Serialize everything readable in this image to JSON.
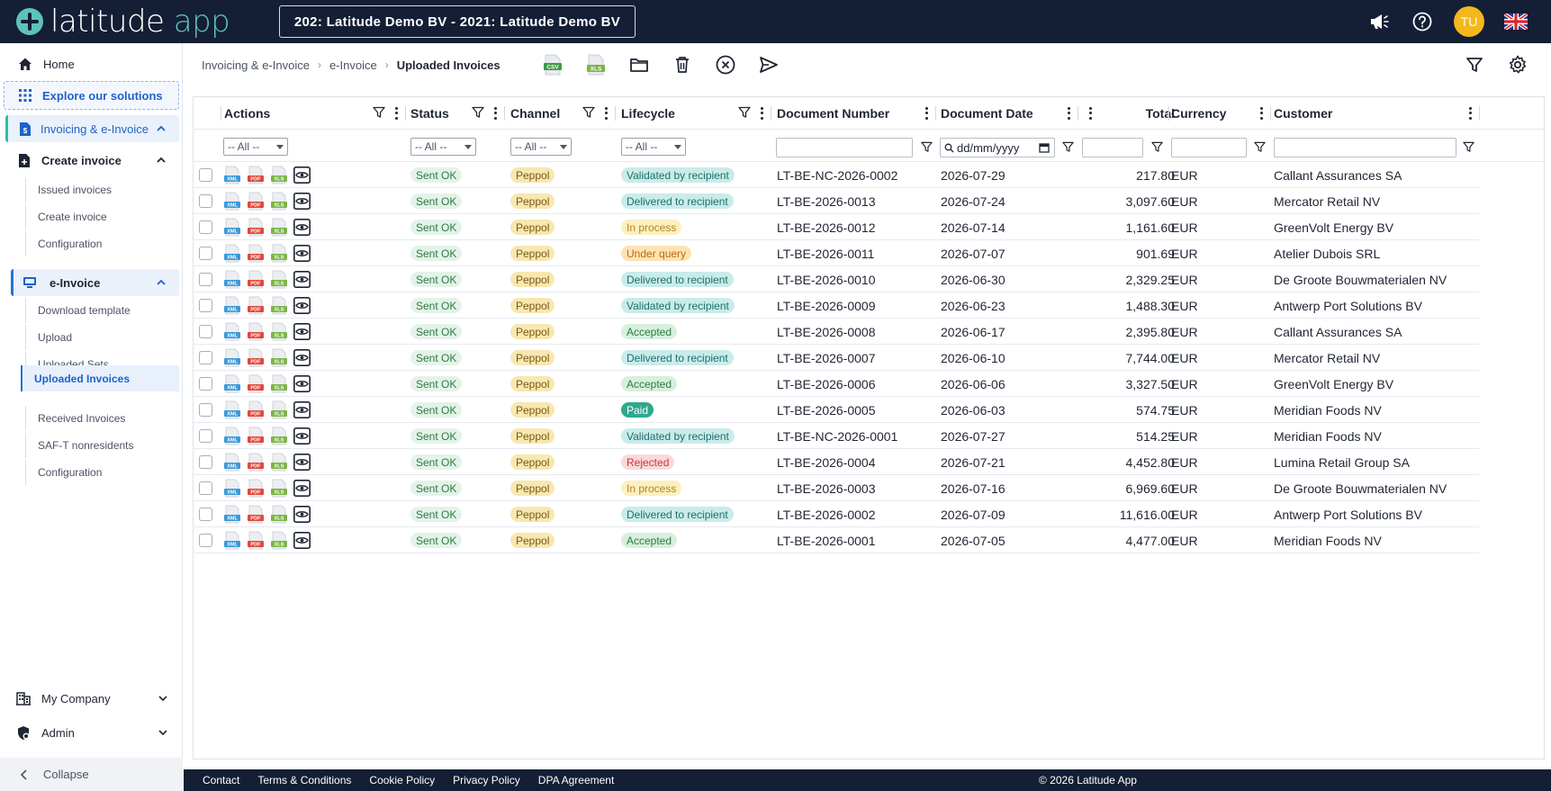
{
  "app": {
    "logo_text_1": "latitude",
    "logo_text_2": " app",
    "company_selector": "202: Latitude Demo BV - 2021: Latitude Demo BV",
    "user_initials": "TU"
  },
  "sidebar": {
    "home": "Home",
    "explore": "Explore our solutions",
    "invoicing": "Invoicing & e-Invoice",
    "create_invoice_group": "Create invoice",
    "create_items": [
      "Issued invoices",
      "Create invoice",
      "Configuration"
    ],
    "einvoice_group": "e-Invoice",
    "einvoice_items": [
      "Download template",
      "Upload",
      "Uploaded Sets",
      "Uploaded Invoices",
      "Received Invoices",
      "SAF-T nonresidents",
      "Configuration"
    ],
    "active_item": "Uploaded Invoices",
    "my_company": "My Company",
    "admin": "Admin",
    "collapse": "Collapse"
  },
  "breadcrumb": [
    "Invoicing & e-Invoice",
    "e-Invoice",
    "Uploaded Invoices"
  ],
  "toolbar": {
    "csv_label": "CSV",
    "xls_label": "XLS"
  },
  "grid": {
    "columns": {
      "actions": "Actions",
      "status": "Status",
      "channel": "Channel",
      "lifecycle": "Lifecycle",
      "document_number": "Document Number",
      "document_date": "Document Date",
      "total": "Total",
      "currency": "Currency",
      "customer": "Customer"
    },
    "filters": {
      "all_option": "-- All --",
      "date_placeholder": "dd/mm/yyyy"
    },
    "file_icons": [
      "XML",
      "PDF",
      "XLS"
    ],
    "rows": [
      {
        "status": "Sent OK",
        "channel": "Peppol",
        "lifecycle": "Validated by recipient",
        "lifecycle_kind": "teal",
        "doc": "LT-BE-NC-2026-0002",
        "date": "2026-07-29",
        "total": "217.80",
        "currency": "EUR",
        "customer": "Callant Assurances SA"
      },
      {
        "status": "Sent OK",
        "channel": "Peppol",
        "lifecycle": "Delivered to recipient",
        "lifecycle_kind": "teal",
        "doc": "LT-BE-2026-0013",
        "date": "2026-07-24",
        "total": "3,097.60",
        "currency": "EUR",
        "customer": "Mercator Retail NV"
      },
      {
        "status": "Sent OK",
        "channel": "Peppol",
        "lifecycle": "In process",
        "lifecycle_kind": "amber",
        "doc": "LT-BE-2026-0012",
        "date": "2026-07-14",
        "total": "1,161.60",
        "currency": "EUR",
        "customer": "GreenVolt Energy BV"
      },
      {
        "status": "Sent OK",
        "channel": "Peppol",
        "lifecycle": "Under query",
        "lifecycle_kind": "orange",
        "doc": "LT-BE-2026-0011",
        "date": "2026-07-07",
        "total": "901.69",
        "currency": "EUR",
        "customer": "Atelier Dubois SRL"
      },
      {
        "status": "Sent OK",
        "channel": "Peppol",
        "lifecycle": "Delivered to recipient",
        "lifecycle_kind": "teal",
        "doc": "LT-BE-2026-0010",
        "date": "2026-06-30",
        "total": "2,329.25",
        "currency": "EUR",
        "customer": "De Groote Bouwmaterialen NV"
      },
      {
        "status": "Sent OK",
        "channel": "Peppol",
        "lifecycle": "Validated by recipient",
        "lifecycle_kind": "teal",
        "doc": "LT-BE-2026-0009",
        "date": "2026-06-23",
        "total": "1,488.30",
        "currency": "EUR",
        "customer": "Antwerp Port Solutions BV"
      },
      {
        "status": "Sent OK",
        "channel": "Peppol",
        "lifecycle": "Accepted",
        "lifecycle_kind": "green",
        "doc": "LT-BE-2026-0008",
        "date": "2026-06-17",
        "total": "2,395.80",
        "currency": "EUR",
        "customer": "Callant Assurances SA"
      },
      {
        "status": "Sent OK",
        "channel": "Peppol",
        "lifecycle": "Delivered to recipient",
        "lifecycle_kind": "teal",
        "doc": "LT-BE-2026-0007",
        "date": "2026-06-10",
        "total": "7,744.00",
        "currency": "EUR",
        "customer": "Mercator Retail NV"
      },
      {
        "status": "Sent OK",
        "channel": "Peppol",
        "lifecycle": "Accepted",
        "lifecycle_kind": "green",
        "doc": "LT-BE-2026-0006",
        "date": "2026-06-06",
        "total": "3,327.50",
        "currency": "EUR",
        "customer": "GreenVolt Energy BV"
      },
      {
        "status": "Sent OK",
        "channel": "Peppol",
        "lifecycle": "Paid",
        "lifecycle_kind": "paid",
        "doc": "LT-BE-2026-0005",
        "date": "2026-06-03",
        "total": "574.75",
        "currency": "EUR",
        "customer": "Meridian Foods NV"
      },
      {
        "status": "Sent OK",
        "channel": "Peppol",
        "lifecycle": "Validated by recipient",
        "lifecycle_kind": "teal",
        "doc": "LT-BE-NC-2026-0001",
        "date": "2026-07-27",
        "total": "514.25",
        "currency": "EUR",
        "customer": "Meridian Foods NV"
      },
      {
        "status": "Sent OK",
        "channel": "Peppol",
        "lifecycle": "Rejected",
        "lifecycle_kind": "red",
        "doc": "LT-BE-2026-0004",
        "date": "2026-07-21",
        "total": "4,452.80",
        "currency": "EUR",
        "customer": "Lumina Retail Group SA"
      },
      {
        "status": "Sent OK",
        "channel": "Peppol",
        "lifecycle": "In process",
        "lifecycle_kind": "amber",
        "doc": "LT-BE-2026-0003",
        "date": "2026-07-16",
        "total": "6,969.60",
        "currency": "EUR",
        "customer": "De Groote Bouwmaterialen NV"
      },
      {
        "status": "Sent OK",
        "channel": "Peppol",
        "lifecycle": "Delivered to recipient",
        "lifecycle_kind": "teal",
        "doc": "LT-BE-2026-0002",
        "date": "2026-07-09",
        "total": "11,616.00",
        "currency": "EUR",
        "customer": "Antwerp Port Solutions BV"
      },
      {
        "status": "Sent OK",
        "channel": "Peppol",
        "lifecycle": "Accepted",
        "lifecycle_kind": "green",
        "doc": "LT-BE-2026-0001",
        "date": "2026-07-05",
        "total": "4,477.00",
        "currency": "EUR",
        "customer": "Meridian Foods NV"
      }
    ]
  },
  "footer": {
    "links": [
      "Contact",
      "Terms & Conditions",
      "Cookie Policy",
      "Privacy Policy",
      "DPA Agreement"
    ],
    "copyright": "© 2026 Latitude App"
  },
  "colors": {
    "topbar": "#141e35",
    "accent": "#5ec2b8",
    "link_blue": "#1f62c7",
    "badge_teal_bg": "#c9ecea",
    "badge_teal_fg": "#1d6f6a",
    "badge_amber_bg": "#fbf0bf",
    "badge_amber_fg": "#b7861b",
    "badge_orange_bg": "#fde3b3",
    "badge_orange_fg": "#b76b12",
    "badge_green_bg": "#d6f0dc",
    "badge_green_fg": "#2e7a45",
    "badge_paid_bg": "#2fa88e",
    "badge_paid_fg": "#ffffff",
    "badge_red_bg": "#fbd9d9",
    "badge_red_fg": "#c23a3a"
  }
}
